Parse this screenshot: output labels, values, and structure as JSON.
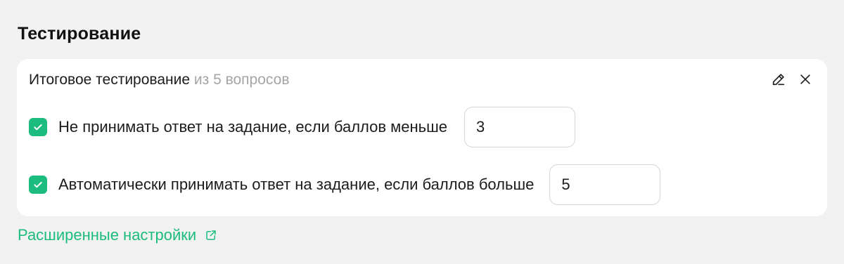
{
  "section": {
    "title": "Тестирование"
  },
  "card": {
    "title": "Итоговое тестирование",
    "subtitle": "из 5 вопросов",
    "actions": {
      "edit_icon": "pencil-icon",
      "close_icon": "close-icon"
    },
    "rules": [
      {
        "checked": true,
        "label": "Не принимать ответ на задание, если баллов меньше",
        "value": "3"
      },
      {
        "checked": true,
        "label": "Автоматически принимать ответ на задание, если баллов больше",
        "value": "5"
      }
    ]
  },
  "advanced_link": {
    "label": "Расширенные настройки",
    "icon": "external-link-icon"
  },
  "colors": {
    "accent": "#1bbc7d",
    "muted_text": "#a5a5a5",
    "background": "#f2f2f2",
    "card": "#ffffff"
  }
}
